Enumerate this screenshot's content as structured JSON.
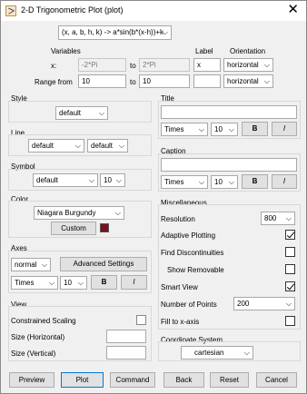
{
  "window": {
    "title": "2-D Trigonometric Plot (plot)",
    "close": "✕"
  },
  "formula": {
    "value": "(x, a, b, h, k) -> a*sin(b*(x-h))+k"
  },
  "variables": {
    "header": "Variables",
    "label_header": "Label",
    "orientation_header": "Orientation",
    "x_label": "x:",
    "x_from": "-2*Pi",
    "to1": "to",
    "x_to": "2*Pi",
    "x_name": "x",
    "x_orientation": "horizontal",
    "range_label": "Range from",
    "range_from": "10",
    "to2": "to",
    "range_to": "10",
    "range_name": "",
    "range_orientation": "horizontal"
  },
  "style": {
    "header": "Style",
    "value": "default"
  },
  "line": {
    "header": "Line",
    "style": "default",
    "width": "default"
  },
  "symbol": {
    "header": "Symbol",
    "style": "default",
    "size": "10"
  },
  "color": {
    "header": "Color",
    "value": "Niagara Burgundy",
    "custom_label": "Custom",
    "swatch": "#7a1020"
  },
  "axes": {
    "header": "Axes",
    "mode": "normal",
    "advanced_label": "Advanced Settings",
    "font": "Times",
    "size": "10",
    "bold": "B",
    "italic": "I"
  },
  "view": {
    "header": "View",
    "constrained_label": "Constrained Scaling",
    "size_h_label": "Size (Horizontal)",
    "size_v_label": "Size (Vertical)",
    "size_h": "",
    "size_v": ""
  },
  "title_group": {
    "header": "Title",
    "value": "",
    "font": "Times",
    "size": "10",
    "bold": "B",
    "italic": "I"
  },
  "caption_group": {
    "header": "Caption",
    "value": "",
    "font": "Times",
    "size": "10",
    "bold": "B",
    "italic": "I"
  },
  "misc": {
    "header": "Miscellaneous",
    "resolution_label": "Resolution",
    "resolution": "800",
    "adaptive_label": "Adaptive Plotting",
    "adaptive": true,
    "discont_label": "Find Discontinuities",
    "discont": false,
    "removable_label": "Show Removable",
    "removable": false,
    "smart_label": "Smart View",
    "smart": true,
    "points_label": "Number of Points",
    "points": "200",
    "fill_label": "Fill to x-axis",
    "fill": false
  },
  "coords": {
    "header": "Coordinate System",
    "value": "cartesian"
  },
  "buttons": {
    "preview": "Preview",
    "plot": "Plot",
    "command": "Command",
    "back": "Back",
    "reset": "Reset",
    "cancel": "Cancel"
  }
}
